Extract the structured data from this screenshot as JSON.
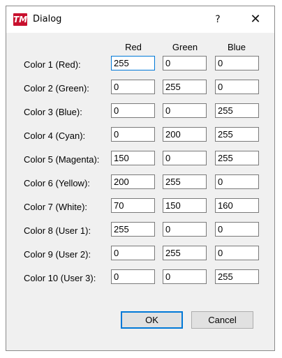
{
  "window": {
    "title": "Dialog",
    "app_icon_text": "TM",
    "help_glyph": "?",
    "close_glyph": "✕"
  },
  "columns": [
    "Red",
    "Green",
    "Blue"
  ],
  "rows": [
    {
      "label": "Color 1 (Red):",
      "values": [
        "255",
        "0",
        "0"
      ]
    },
    {
      "label": "Color 2 (Green):",
      "values": [
        "0",
        "255",
        "0"
      ]
    },
    {
      "label": "Color 3 (Blue):",
      "values": [
        "0",
        "0",
        "255"
      ]
    },
    {
      "label": "Color 4 (Cyan):",
      "values": [
        "0",
        "200",
        "255"
      ]
    },
    {
      "label": "Color 5 (Magenta):",
      "values": [
        "150",
        "0",
        "255"
      ]
    },
    {
      "label": "Color 6 (Yellow):",
      "values": [
        "200",
        "255",
        "0"
      ]
    },
    {
      "label": "Color 7 (White):",
      "values": [
        "70",
        "150",
        "160"
      ]
    },
    {
      "label": "Color 8 (User 1):",
      "values": [
        "255",
        "0",
        "0"
      ]
    },
    {
      "label": "Color 9 (User 2):",
      "values": [
        "0",
        "255",
        "0"
      ]
    },
    {
      "label": "Color 10 (User 3):",
      "values": [
        "0",
        "0",
        "255"
      ]
    }
  ],
  "buttons": {
    "ok": "OK",
    "cancel": "Cancel"
  },
  "colors": {
    "accent": "#0078d7",
    "app_icon": "#c8102e"
  }
}
